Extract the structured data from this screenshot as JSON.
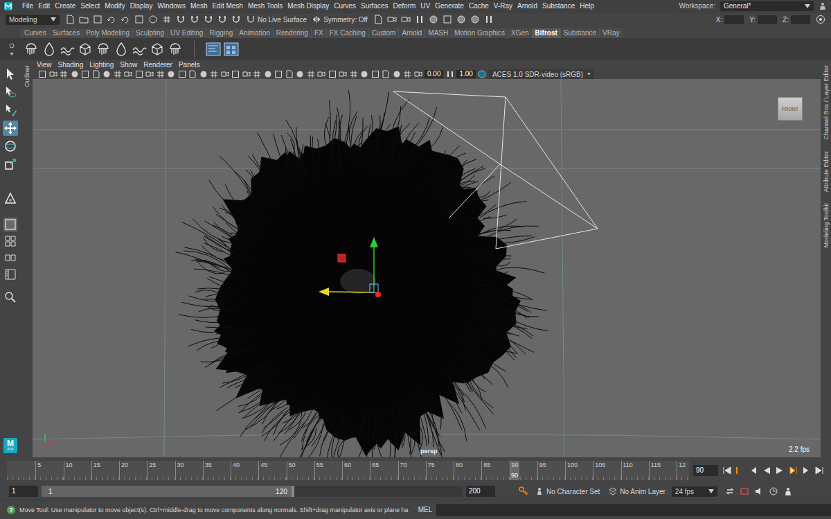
{
  "menu_bar": {
    "items": [
      "File",
      "Edit",
      "Create",
      "Select",
      "Modify",
      "Display",
      "Windows",
      "Mesh",
      "Edit Mesh",
      "Mesh Tools",
      "Mesh Display",
      "Curves",
      "Surfaces",
      "Deform",
      "UV",
      "Generate",
      "Cache",
      "V-Ray",
      "Arnold",
      "Substance",
      "Help"
    ],
    "workspace_label": "Workspace:",
    "workspace_value": "General*"
  },
  "status_line": {
    "mode": "Modeling",
    "live_surface": "No Live Surface",
    "symmetry": "Symmetry: Off",
    "coordinate_labels": [
      "X:",
      "Y:",
      "Z:"
    ]
  },
  "shelf": {
    "tabs": [
      {
        "label": "Curves",
        "selected": false
      },
      {
        "label": "Surfaces",
        "selected": false
      },
      {
        "label": "Poly Modeling",
        "selected": false
      },
      {
        "label": "Sculpting",
        "selected": false
      },
      {
        "label": "UV Editing",
        "selected": false
      },
      {
        "label": "Rigging",
        "selected": false
      },
      {
        "label": "Animation",
        "selected": false
      },
      {
        "label": "Rendering",
        "selected": false
      },
      {
        "label": "FX",
        "selected": false
      },
      {
        "label": "FX Caching",
        "selected": false
      },
      {
        "label": "Custom",
        "selected": false
      },
      {
        "label": "Arnold",
        "selected": false
      },
      {
        "label": "MASH",
        "selected": false
      },
      {
        "label": "Motion Graphics",
        "selected": false
      },
      {
        "label": "XGen",
        "selected": false
      },
      {
        "label": "Bifrost",
        "selected": true
      },
      {
        "label": "Substance",
        "selected": false
      },
      {
        "label": "VRay",
        "selected": false
      }
    ]
  },
  "toolbox": {
    "tools": [
      {
        "kind": "select",
        "selected": false
      },
      {
        "kind": "lasso",
        "selected": false
      },
      {
        "kind": "paint",
        "selected": false
      },
      {
        "kind": "move",
        "selected": true
      },
      {
        "kind": "rotate",
        "selected": false
      },
      {
        "kind": "scale",
        "selected": false
      },
      {
        "kind": "last-tool",
        "selected": false
      }
    ],
    "layouts": [
      {
        "kind": "single",
        "selected": true
      },
      {
        "kind": "four",
        "selected": false
      },
      {
        "kind": "side-by-side",
        "selected": false
      },
      {
        "kind": "outliner-persp",
        "selected": false
      }
    ],
    "logo": {
      "letter": "M",
      "caption": "AYA"
    }
  },
  "outliner_tab": "Outliner",
  "viewport": {
    "menus": [
      "View",
      "Shading",
      "Lighting",
      "Show",
      "Renderer",
      "Panels"
    ],
    "exposure": "0.00",
    "gamma": "1.00",
    "color_space": "ACES 1.0 SDR-video (sRGB)",
    "view_cube": "FRONT",
    "camera": "persp",
    "fps": "2.2 fps"
  },
  "side_tabs": [
    "Channel Box / Layer Editor",
    "Attribute Editor",
    "Modeling Toolkit"
  ],
  "time_slider": {
    "ticks": [
      "5",
      "10",
      "15",
      "20",
      "25",
      "30",
      "35",
      "40",
      "45",
      "50",
      "55",
      "60",
      "65",
      "70",
      "75",
      "80",
      "85",
      "90",
      "95",
      "100",
      "105",
      "110",
      "115",
      "12"
    ],
    "current_frame": "90",
    "level": 0.737,
    "frame_field": "90"
  },
  "range_slider": {
    "start_field": "1",
    "range_start": "1",
    "range_end": "120",
    "end_field": "200",
    "level": 0.6,
    "character_set": "No Character Set",
    "anim_layer": "No Anim Layer",
    "fps": "24 fps"
  },
  "command_line": {
    "help_icon": "?",
    "help": "Move Tool: Use manipulator to move object(s). Ctrl+middle-drag to move components along normals. Shift+drag manipulator axis or plane ha",
    "language": "MEL"
  }
}
